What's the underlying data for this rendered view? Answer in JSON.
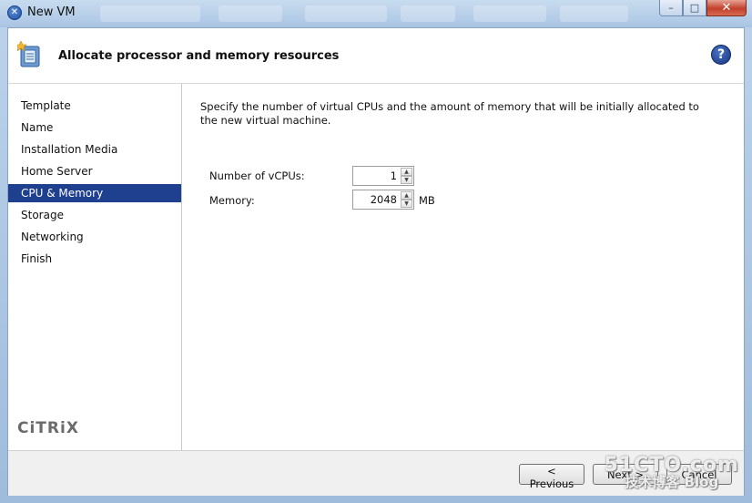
{
  "window": {
    "title": "New VM",
    "minimize_glyph": "–",
    "maximize_glyph": "□",
    "close_glyph": "✕"
  },
  "header": {
    "title": "Allocate processor and memory resources",
    "help_glyph": "?"
  },
  "sidebar": {
    "items": [
      {
        "label": "Template"
      },
      {
        "label": "Name"
      },
      {
        "label": "Installation Media"
      },
      {
        "label": "Home Server"
      },
      {
        "label": "CPU & Memory"
      },
      {
        "label": "Storage"
      },
      {
        "label": "Networking"
      },
      {
        "label": "Finish"
      }
    ],
    "active_index": 4,
    "brand": "CiTRiX"
  },
  "main": {
    "instruction": "Specify the number of virtual CPUs and the amount of memory that will be initially allocated to the new virtual machine.",
    "vcpus": {
      "label": "Number of vCPUs:",
      "value": "1"
    },
    "memory": {
      "label": "Memory:",
      "value": "2048",
      "unit": "MB"
    }
  },
  "footer": {
    "previous_label": "< Previous",
    "next_label": "Next >",
    "cancel_label": "Cancel"
  },
  "watermark": {
    "line1": "51CTO.com",
    "line2": "技术博客 Blog"
  },
  "colors": {
    "selection": "#1f3f8f",
    "title_bar": "#b4cce8",
    "close_button": "#c2412c"
  }
}
